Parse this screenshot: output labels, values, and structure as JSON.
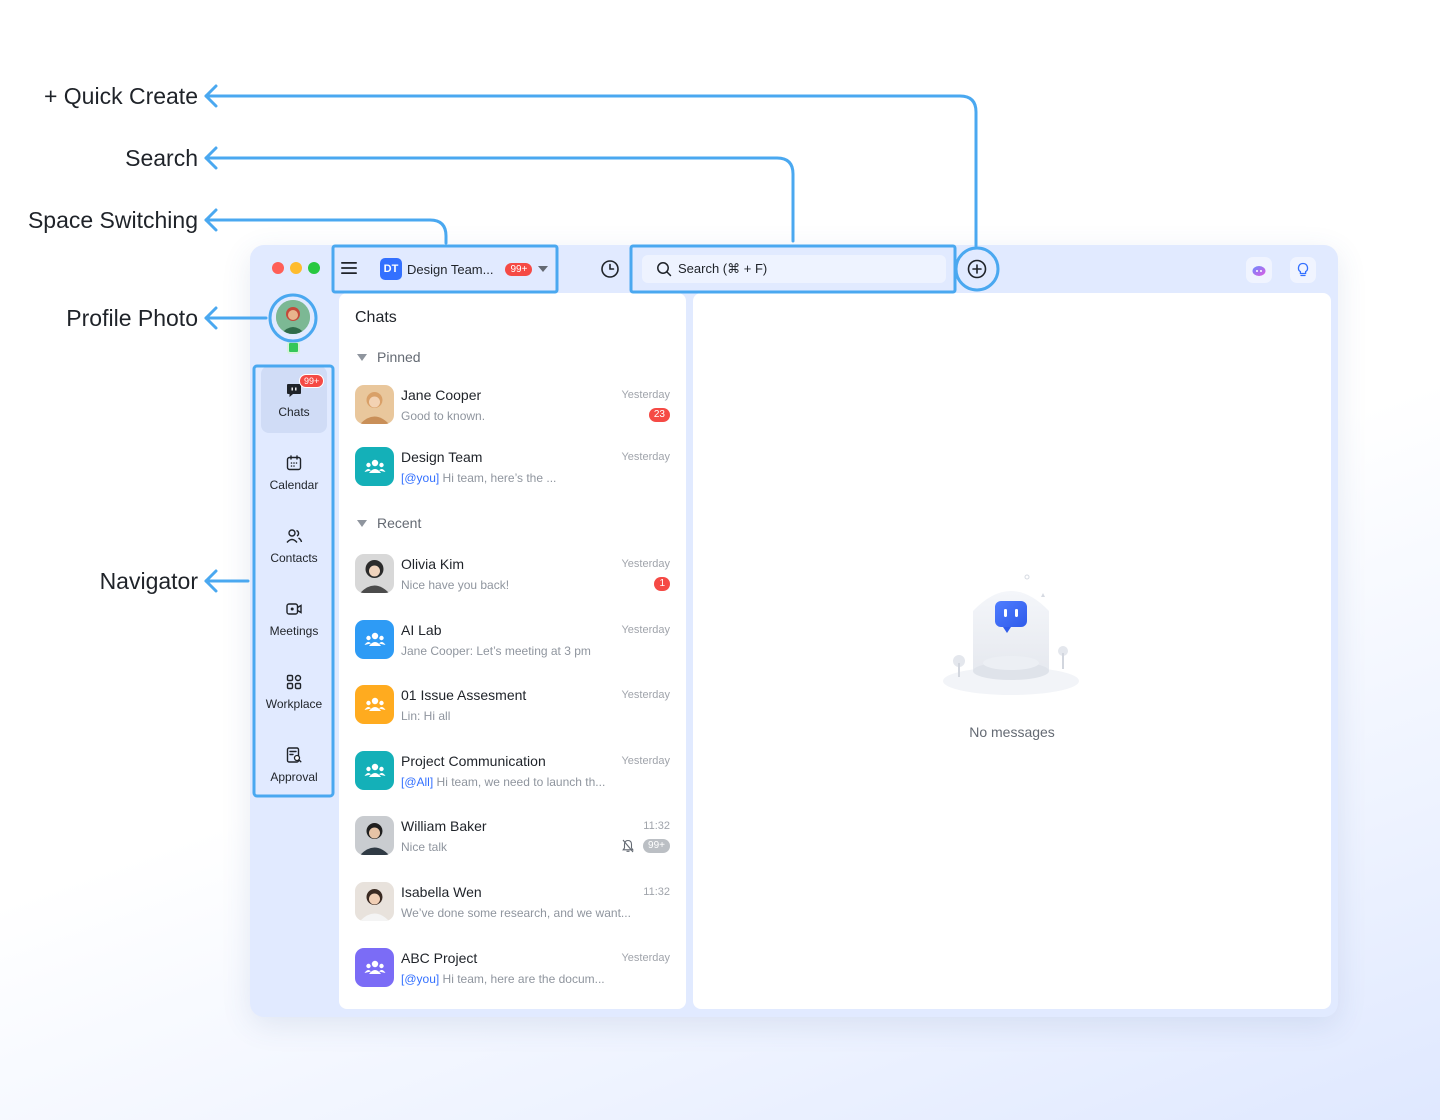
{
  "callouts": {
    "quick_create": "+ Quick Create",
    "search": "Search",
    "space_switching": "Space Switching",
    "profile_photo": "Profile Photo",
    "navigator": "Navigator"
  },
  "colors": {
    "accent": "#3370ff",
    "callout_line": "#4aa8f0",
    "badge_red": "#f54a45",
    "window_bg": "#e1eaff"
  },
  "header": {
    "space_logo": "DT",
    "space_name": "Design Team...",
    "space_badge": "99+",
    "search_placeholder": "Search (⌘ + F)",
    "menu_icon": "hamburger-icon",
    "history_icon": "clock-icon",
    "quick_create_icon": "plus-circle-icon"
  },
  "sidebar": {
    "status": "online",
    "items": [
      {
        "label": "Chats",
        "icon": "chat-bubble-icon",
        "badge": "99+",
        "active": true
      },
      {
        "label": "Calendar",
        "icon": "calendar-icon"
      },
      {
        "label": "Contacts",
        "icon": "contacts-icon"
      },
      {
        "label": "Meetings",
        "icon": "video-camera-icon"
      },
      {
        "label": "Workplace",
        "icon": "grid-icon"
      },
      {
        "label": "Approval",
        "icon": "approval-document-icon"
      }
    ]
  },
  "chatlist": {
    "title": "Chats",
    "sections": {
      "pinned": "Pinned",
      "recent": "Recent"
    },
    "chats": [
      {
        "name": "Jane Cooper",
        "mention": "",
        "preview": "Good to known.",
        "time": "Yesterday",
        "badge": "23",
        "avatar": "photo",
        "avatar_color": "#d9a068"
      },
      {
        "name": "Design Team",
        "mention": "[@you]",
        "preview": " Hi team, here’s the ...",
        "time": "Yesterday",
        "badge": "",
        "avatar": "group",
        "avatar_color": "#14b0b8"
      },
      {
        "name": "Olivia Kim",
        "mention": "",
        "preview": "Nice have you back!",
        "time": "Yesterday",
        "badge": "1",
        "avatar": "photo",
        "avatar_color": "#4b4b4b"
      },
      {
        "name": "AI Lab",
        "mention": "",
        "preview": "Jane Cooper: Let’s meeting at 3 pm",
        "time": "Yesterday",
        "badge": "",
        "avatar": "group",
        "avatar_color": "#2e9bf5"
      },
      {
        "name": "01 Issue Assesment",
        "mention": "",
        "preview": "Lin: Hi all",
        "time": "Yesterday",
        "badge": "",
        "avatar": "group",
        "avatar_color": "#ffab1f"
      },
      {
        "name": "Project Communication",
        "mention": "[@All]",
        "preview": " Hi team, we need to launch th...",
        "time": "Yesterday",
        "badge": "",
        "avatar": "group",
        "avatar_color": "#14b0b8"
      },
      {
        "name": "William Baker",
        "mention": "",
        "preview": "Nice talk",
        "time": "11:32",
        "badge": "99+",
        "muted": true,
        "avatar": "photo",
        "avatar_color": "#2f3a44"
      },
      {
        "name": "Isabella Wen",
        "mention": "",
        "preview": "We’ve done some research, and we want...",
        "time": "11:32",
        "badge": "",
        "avatar": "photo",
        "avatar_color": "#6b4a3a"
      },
      {
        "name": "ABC Project",
        "mention": "[@you]",
        "preview": " Hi team, here are the docum...",
        "time": "Yesterday",
        "badge": "",
        "avatar": "group",
        "avatar_color": "#7b6cf6"
      }
    ]
  },
  "main": {
    "empty_text": "No messages",
    "illustration": "robot-chat-illustration"
  }
}
